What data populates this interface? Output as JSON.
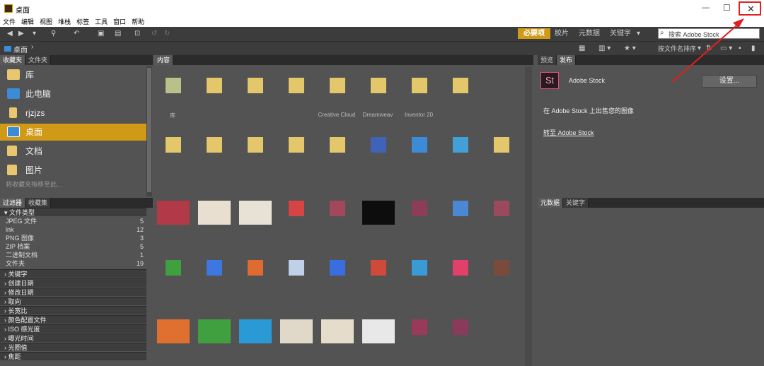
{
  "window": {
    "title": "桌面",
    "controls": {
      "minimize": "—",
      "maximize": "☐",
      "close": "✕"
    }
  },
  "menu": [
    "文件",
    "编辑",
    "视图",
    "堆栈",
    "标签",
    "工具",
    "窗口",
    "帮助"
  ],
  "toolbar": {
    "workspace_active": "必要项",
    "workspaces": [
      "胶片",
      "元数据",
      "关键字"
    ],
    "search_placeholder": "搜索 Adobe Stock",
    "breadcrumb": "桌面",
    "sort_label": "按文件名排序"
  },
  "left_top": {
    "tabs": [
      "收藏夹",
      "文件夹"
    ],
    "items": [
      {
        "label": "库",
        "icon": "library-icon"
      },
      {
        "label": "此电脑",
        "icon": "computer-icon"
      },
      {
        "label": "rjzjzs",
        "icon": "user-folder-icon"
      },
      {
        "label": "桌面",
        "icon": "desktop-icon"
      },
      {
        "label": "文档",
        "icon": "documents-icon"
      },
      {
        "label": "图片",
        "icon": "pictures-icon"
      }
    ],
    "hint": "将收藏夹拖移至此..."
  },
  "filter": {
    "tabs": [
      "过滤器",
      "收藏集"
    ],
    "file_type_header": "文件类型",
    "file_types": [
      {
        "label": "JPEG 文件",
        "count": "5"
      },
      {
        "label": "lnk",
        "count": "12"
      },
      {
        "label": "PNG 图像",
        "count": "3"
      },
      {
        "label": "ZIP 档案",
        "count": "5"
      },
      {
        "label": "二进制文档",
        "count": "1"
      },
      {
        "label": "文件夹",
        "count": "19"
      }
    ],
    "sections": [
      "关键字",
      "创建日期",
      "修改日期",
      "取向",
      "长宽比",
      "颜色配置文件",
      "ISO 感光度",
      "曝光时间",
      "光圈值",
      "焦距"
    ]
  },
  "content": {
    "tab": "内容",
    "row1_labels": [
      "库",
      "",
      "",
      "",
      "Creative Cloud",
      "Dreamweav",
      "Inventor 20",
      ""
    ],
    "row1_colors": [
      "#b9c08a",
      "#e4c76a",
      "#e4c76a",
      "#e4c76a",
      "#e4c76a",
      "#e4c76a",
      "#e4c76a",
      "#e4c76a"
    ],
    "row2_colors": [
      "#e4c76a",
      "#e4c76a",
      "#e4c76a",
      "#e4c76a",
      "#e4c76a",
      "#3f63b8",
      "#3b8bd6",
      "#42a0d6",
      "#e4c76a"
    ],
    "row3_colors": [
      "#b23a48",
      "#e8dfd0",
      "#e8e2d6",
      "#d64545",
      "#a3475a",
      "#0d0d0d",
      "#8d3d5a",
      "#4a88d4",
      "#9a4a5a"
    ],
    "row4_colors": [
      "#40a040",
      "#3f77e0",
      "#e06b30",
      "#c0d0e8",
      "#3a6ee0",
      "#d04a3a",
      "#3a9ad6",
      "#e0406a",
      "#7a4a3a"
    ],
    "row5_colors": [
      "#e07030",
      "#40a040",
      "#2a9ad6",
      "#e0d8c8",
      "#e6dccc",
      "#e8e8e8",
      "#9a3a5a",
      "#8a3a5a"
    ]
  },
  "preview": {
    "tabs": [
      "预览",
      "发布"
    ],
    "stock_icon_text": "St",
    "stock_title": "Adobe Stock",
    "settings_button": "设置...",
    "publish_text": "在 Adobe Stock 上出售您的图像",
    "goto_link": "转至 Adobe Stock"
  },
  "metadata": {
    "tabs": [
      "元数据",
      "关键字"
    ]
  }
}
